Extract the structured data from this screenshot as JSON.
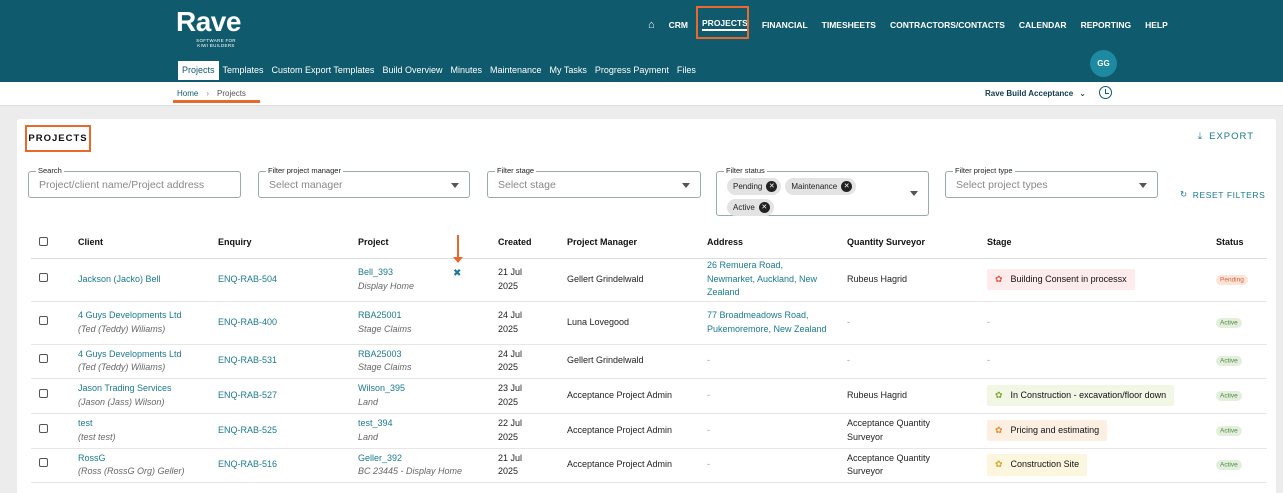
{
  "brand": {
    "name": "Rave",
    "tagline_1": "SOFTWARE FOR",
    "tagline_2": "KIWI BUILDERS"
  },
  "topnav": {
    "items": [
      "CRM",
      "PROJECTS",
      "FINANCIAL",
      "TIMESHEETS",
      "CONTRACTORS/CONTACTS",
      "CALENDAR",
      "REPORTING",
      "HELP"
    ]
  },
  "subnav": {
    "items": [
      "Projects",
      "Templates",
      "Custom Export Templates",
      "Build Overview",
      "Minutes",
      "Maintenance",
      "My Tasks",
      "Progress Payment",
      "Files"
    ]
  },
  "user": {
    "initials": "GG"
  },
  "breadcrumb": {
    "home": "Home",
    "current": "Projects"
  },
  "acceptance_select": "Rave Build Acceptance",
  "page": {
    "title": "PROJECTS",
    "export_label": "EXPORT",
    "reset_label": "RESET FILTERS"
  },
  "filters": {
    "search": {
      "label": "Search",
      "placeholder": "Project/client name/Project address"
    },
    "manager": {
      "label": "Filter project manager",
      "placeholder": "Select manager"
    },
    "stage": {
      "label": "Filter stage",
      "placeholder": "Select stage"
    },
    "status": {
      "label": "Filter status",
      "chips": [
        "Pending",
        "Maintenance",
        "Active"
      ]
    },
    "type": {
      "label": "Filter project type",
      "placeholder": "Select project types"
    }
  },
  "table": {
    "headers": [
      "Client",
      "Enquiry",
      "Project",
      "Created",
      "Project Manager",
      "Address",
      "Quantity Surveyor",
      "Stage",
      "Status"
    ],
    "rows": [
      {
        "client": "Jackson (Jacko) Bell",
        "client_sub": "",
        "enquiry": "ENQ-RAB-504",
        "project": "Bell_393",
        "project_sub": "Display Home",
        "created_1": "21 Jul",
        "created_2": "2025",
        "manager": "Gellert Grindelwald",
        "address": "26 Remuera Road, Newmarket, Auckland, New Zealand",
        "qs": "Rubeus Hagrid",
        "stage": "Building Consent in processx",
        "stage_color": "red",
        "status": "Pending"
      },
      {
        "client": "4 Guys Developments Ltd",
        "client_sub": "(Ted (Teddy) Wiliams)",
        "enquiry": "ENQ-RAB-400",
        "project": "RBA25001",
        "project_sub": "Stage Claims",
        "created_1": "24 Jul",
        "created_2": "2025",
        "manager": "Luna Lovegood",
        "address": "77 Broadmeadows Road, Pukemoremore, New Zealand",
        "qs": "-",
        "stage": "-",
        "stage_color": "",
        "status": "Active"
      },
      {
        "client": "4 Guys Developments Ltd",
        "client_sub": "(Ted (Teddy) Wiliams)",
        "enquiry": "ENQ-RAB-531",
        "project": "RBA25003",
        "project_sub": "Stage Claims",
        "created_1": "24 Jul",
        "created_2": "2025",
        "manager": "Gellert Grindelwald",
        "address": "-",
        "qs": "-",
        "stage": "-",
        "stage_color": "",
        "status": "Active"
      },
      {
        "client": "Jason Trading Services",
        "client_sub": "(Jason (Jass) Wilson)",
        "enquiry": "ENQ-RAB-527",
        "project": "Wilson_395",
        "project_sub": "Land",
        "created_1": "23 Jul",
        "created_2": "2025",
        "manager": "Acceptance Project Admin",
        "address": "-",
        "qs": "Rubeus Hagrid",
        "stage": "In Construction - excavation/floor down",
        "stage_color": "green",
        "status": "Active"
      },
      {
        "client": "test",
        "client_sub": "(test test)",
        "enquiry": "ENQ-RAB-525",
        "project": "test_394",
        "project_sub": "Land",
        "created_1": "22 Jul",
        "created_2": "2025",
        "manager": "Acceptance Project Admin",
        "address": "-",
        "qs": "Acceptance Quantity Surveyor",
        "stage": "Pricing and estimating",
        "stage_color": "orange",
        "status": "Active"
      },
      {
        "client": "RossG",
        "client_sub": "(Ross (RossG Org) Geller)",
        "enquiry": "ENQ-RAB-516",
        "project": "Geller_392",
        "project_sub": "BC 23445 - Display Home",
        "created_1": "21 Jul",
        "created_2": "2025",
        "manager": "Acceptance Project Admin",
        "address": "-",
        "qs": "Acceptance Quantity Surveyor",
        "stage": "Construction Site",
        "stage_color": "yellow",
        "status": "Active"
      }
    ]
  }
}
